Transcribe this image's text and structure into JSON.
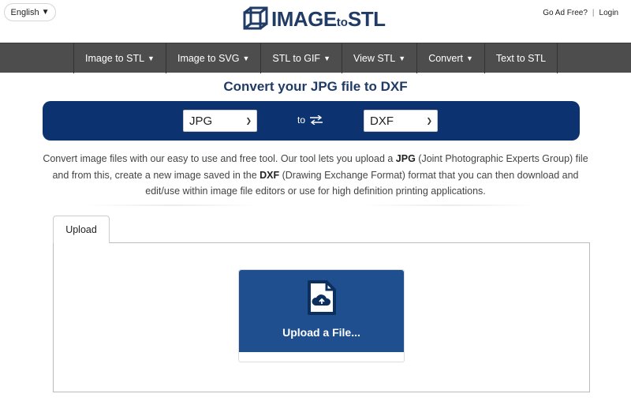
{
  "header": {
    "language": "English",
    "logo_main": "IMAGE",
    "logo_small": "to",
    "logo_end": "STL",
    "links": [
      "Go Ad Free?",
      "Login"
    ],
    "separator": "|"
  },
  "nav": {
    "items": [
      {
        "label": "Image to STL",
        "dropdown": true
      },
      {
        "label": "Image to SVG",
        "dropdown": true
      },
      {
        "label": "STL to GIF",
        "dropdown": true
      },
      {
        "label": "View STL",
        "dropdown": true
      },
      {
        "label": "Convert",
        "dropdown": true
      },
      {
        "label": "Text to STL",
        "dropdown": false
      }
    ]
  },
  "page": {
    "title": "Convert your JPG file to DXF"
  },
  "converter": {
    "from_value": "JPG",
    "to_label": "to",
    "to_value": "DXF",
    "bar_color": "#0c3370"
  },
  "description": {
    "p1": "Convert image files with our easy to use and free tool. Our tool lets you upload a ",
    "b1": "JPG",
    "p2": " (Joint Photographic Experts Group) file and from this, create a new image saved in the ",
    "b2": "DXF",
    "p3": " (Drawing Exchange Format) format that you can then download and edit/use within image file editors or use for high definition printing applications."
  },
  "upload": {
    "tab_label": "Upload",
    "button_label": "Upload a File...",
    "icon": "file-upload-icon"
  },
  "colors": {
    "brand": "#1f3b66",
    "nav_bg": "#4d4d4d",
    "upload_bg": "#1f4f8f"
  }
}
